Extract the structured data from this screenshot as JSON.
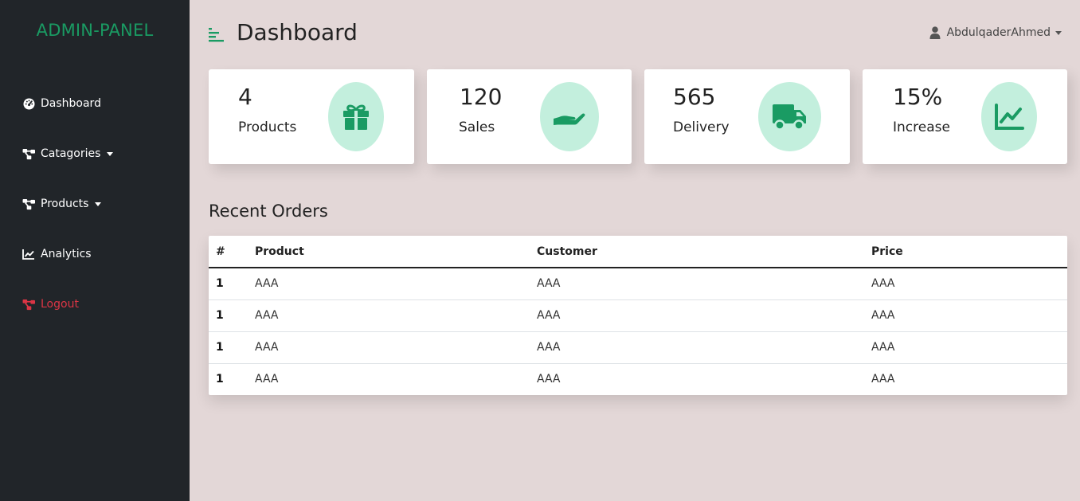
{
  "sidebar": {
    "brand": "ADMIN-PANEL",
    "items": [
      {
        "label": "Dashboard",
        "icon": "dashboard-gauge-icon"
      },
      {
        "label": "Catagories",
        "icon": "sitemap-icon",
        "has_dropdown": true
      },
      {
        "label": "Products",
        "icon": "sitemap-icon",
        "has_dropdown": true
      },
      {
        "label": "Analytics",
        "icon": "line-chart-icon"
      },
      {
        "label": "Logout",
        "icon": "sitemap-icon",
        "color": "#dc3545"
      }
    ]
  },
  "header": {
    "title": "Dashboard",
    "menu_icon": "hamburger-align-left-icon",
    "user": {
      "name": "AbdulqaderAhmed",
      "icon": "user-icon"
    }
  },
  "stats": [
    {
      "value": "4",
      "label": "Products",
      "icon": "gift-icon"
    },
    {
      "value": "120",
      "label": "Sales",
      "icon": "hand-holding-icon"
    },
    {
      "value": "565",
      "label": "Delivery",
      "icon": "truck-icon"
    },
    {
      "value": "15%",
      "label": "Increase",
      "icon": "chart-line-icon"
    }
  ],
  "orders": {
    "title": "Recent Orders",
    "columns": [
      "#",
      "Product",
      "Customer",
      "Price"
    ],
    "rows": [
      [
        "1",
        "AAA",
        "AAA",
        "AAA"
      ],
      [
        "1",
        "AAA",
        "AAA",
        "AAA"
      ],
      [
        "1",
        "AAA",
        "AAA",
        "AAA"
      ],
      [
        "1",
        "AAA",
        "AAA",
        "AAA"
      ]
    ]
  },
  "colors": {
    "accent": "#1a9b63",
    "icon_bg": "#c3efdd",
    "sidebar_bg": "#212529",
    "page_bg": "#e3d7d7",
    "logout": "#dc3545"
  }
}
